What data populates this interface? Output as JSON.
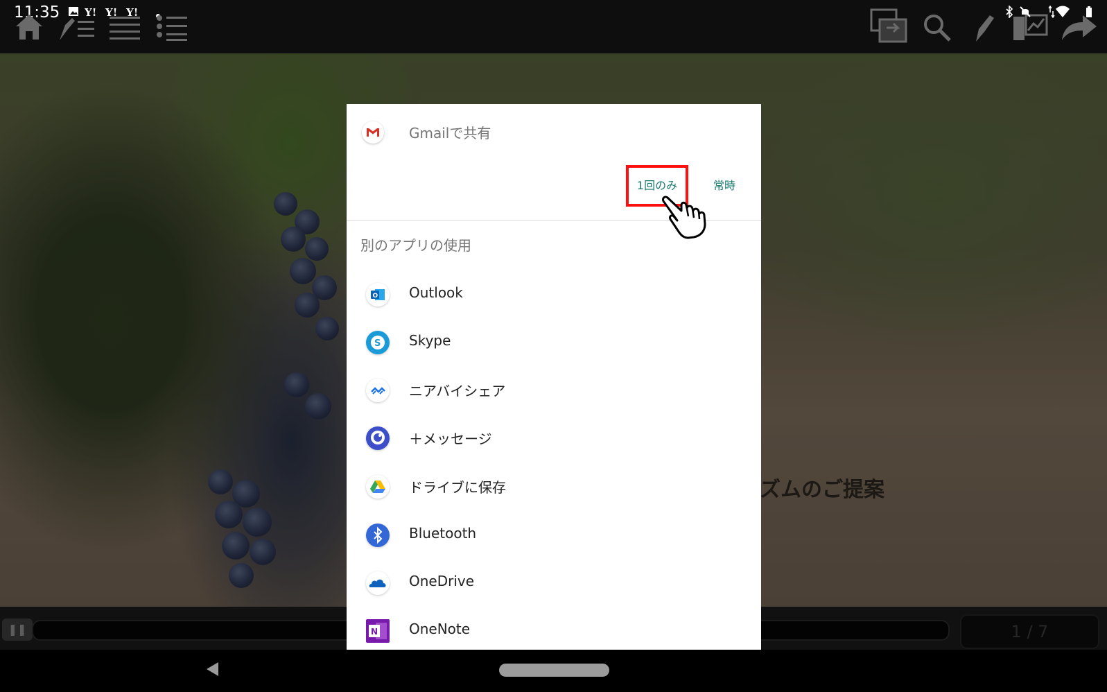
{
  "status_bar": {
    "time": "11:35"
  },
  "slide": {
    "visible_heading_fragment": "ズムのご提案"
  },
  "player": {
    "page_counter": "1 / 7"
  },
  "share_sheet": {
    "title": "Gmailで共有",
    "once_button": "1回のみ",
    "always_button": "常時",
    "other_apps_label": "別のアプリの使用",
    "apps": [
      {
        "label": "Outlook",
        "icon": "outlook-icon"
      },
      {
        "label": "Skype",
        "icon": "skype-icon"
      },
      {
        "label": "ニアバイシェア",
        "icon": "nearby-share-icon"
      },
      {
        "label": "＋メッセージ",
        "icon": "plus-message-icon"
      },
      {
        "label": "ドライブに保存",
        "icon": "drive-icon"
      },
      {
        "label": "Bluetooth",
        "icon": "bluetooth-icon"
      },
      {
        "label": "OneDrive",
        "icon": "onedrive-icon"
      },
      {
        "label": "OneNote",
        "icon": "onenote-icon"
      }
    ]
  },
  "colors": {
    "accent_teal": "#1a7a6e",
    "highlight_red": "#ff1010",
    "gmail_red": "#d93025"
  }
}
